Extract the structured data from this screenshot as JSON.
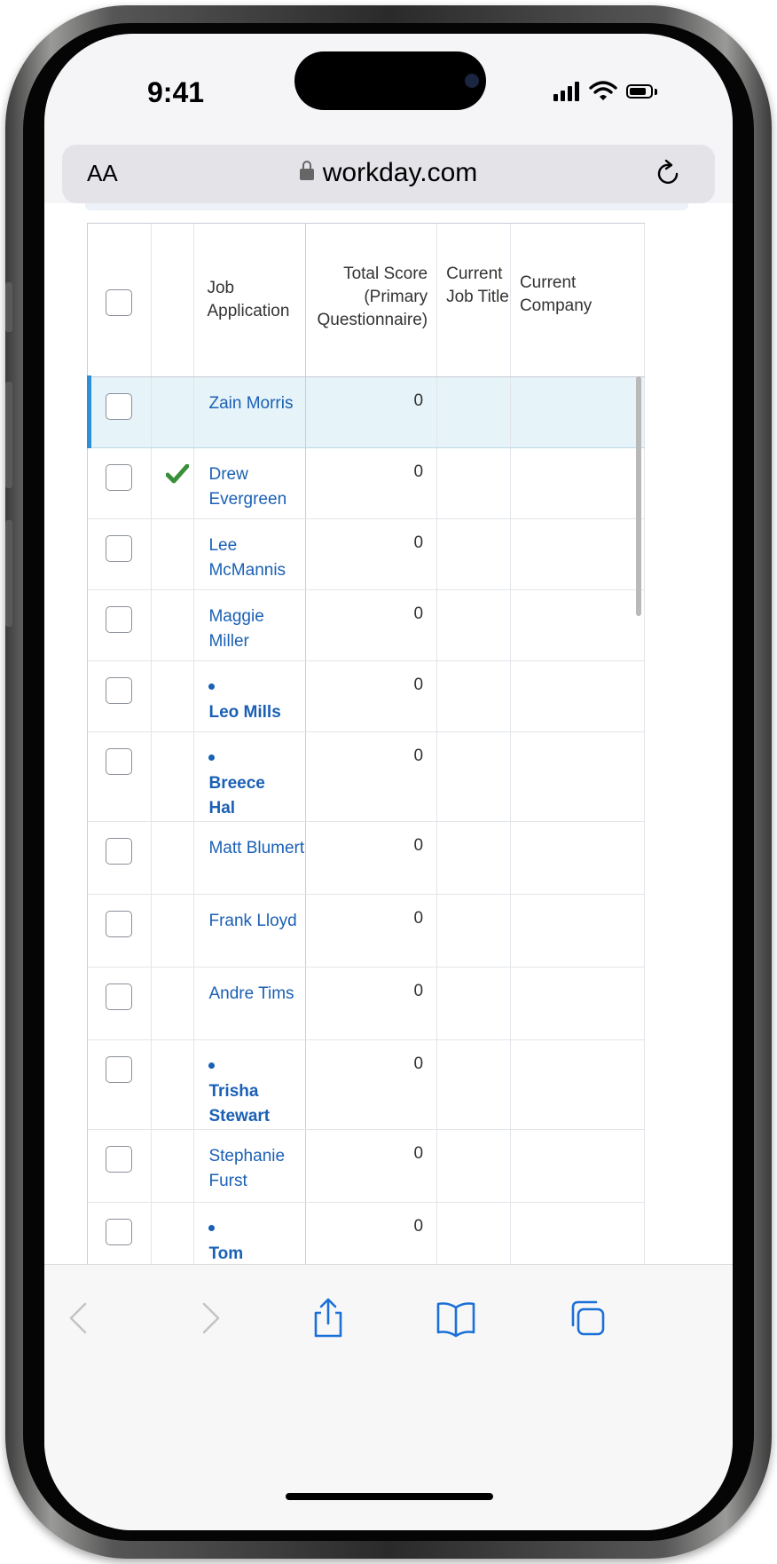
{
  "status_bar": {
    "time": "9:41"
  },
  "browser": {
    "aa_label": "AA",
    "url": "workday.com"
  },
  "table": {
    "headers": {
      "job_application": "Job Application",
      "total_score": "Total Score (Primary Questionnaire)",
      "current_job_title": "Current Job Title",
      "current_company": "Current Company"
    },
    "rows": [
      {
        "name": "Zain Morris",
        "score": "0",
        "selected": true,
        "checkmark": false,
        "new": false
      },
      {
        "name": "Drew Evergreen",
        "score": "0",
        "selected": false,
        "checkmark": true,
        "new": false
      },
      {
        "name": "Lee McMannis",
        "score": "0",
        "selected": false,
        "checkmark": false,
        "new": false
      },
      {
        "name": "Maggie Miller",
        "score": "0",
        "selected": false,
        "checkmark": false,
        "new": false
      },
      {
        "name": "Leo Mills",
        "score": "0",
        "selected": false,
        "checkmark": false,
        "new": true
      },
      {
        "name": "Breece Hal",
        "score": "0",
        "selected": false,
        "checkmark": false,
        "new": true
      },
      {
        "name": "Matt Blumert",
        "score": "0",
        "selected": false,
        "checkmark": false,
        "new": false
      },
      {
        "name": "Frank Lloyd",
        "score": "0",
        "selected": false,
        "checkmark": false,
        "new": false
      },
      {
        "name": "Andre Tims",
        "score": "0",
        "selected": false,
        "checkmark": false,
        "new": false
      },
      {
        "name": "Trisha Stewart",
        "score": "0",
        "selected": false,
        "checkmark": false,
        "new": true
      },
      {
        "name": "Stephanie Furst",
        "score": "0",
        "selected": false,
        "checkmark": false,
        "new": false
      },
      {
        "name": "Tom Millerton",
        "score": "0",
        "selected": false,
        "checkmark": false,
        "new": true
      }
    ]
  },
  "colors": {
    "link": "#1a60b5",
    "selected_row": "#e6f3f8",
    "selected_bar": "#2c8fd8",
    "checkmark": "#3a8f3a"
  },
  "toolbar": {
    "icons": [
      "back-icon",
      "forward-icon",
      "share-icon",
      "bookmarks-icon",
      "tabs-icon"
    ]
  }
}
